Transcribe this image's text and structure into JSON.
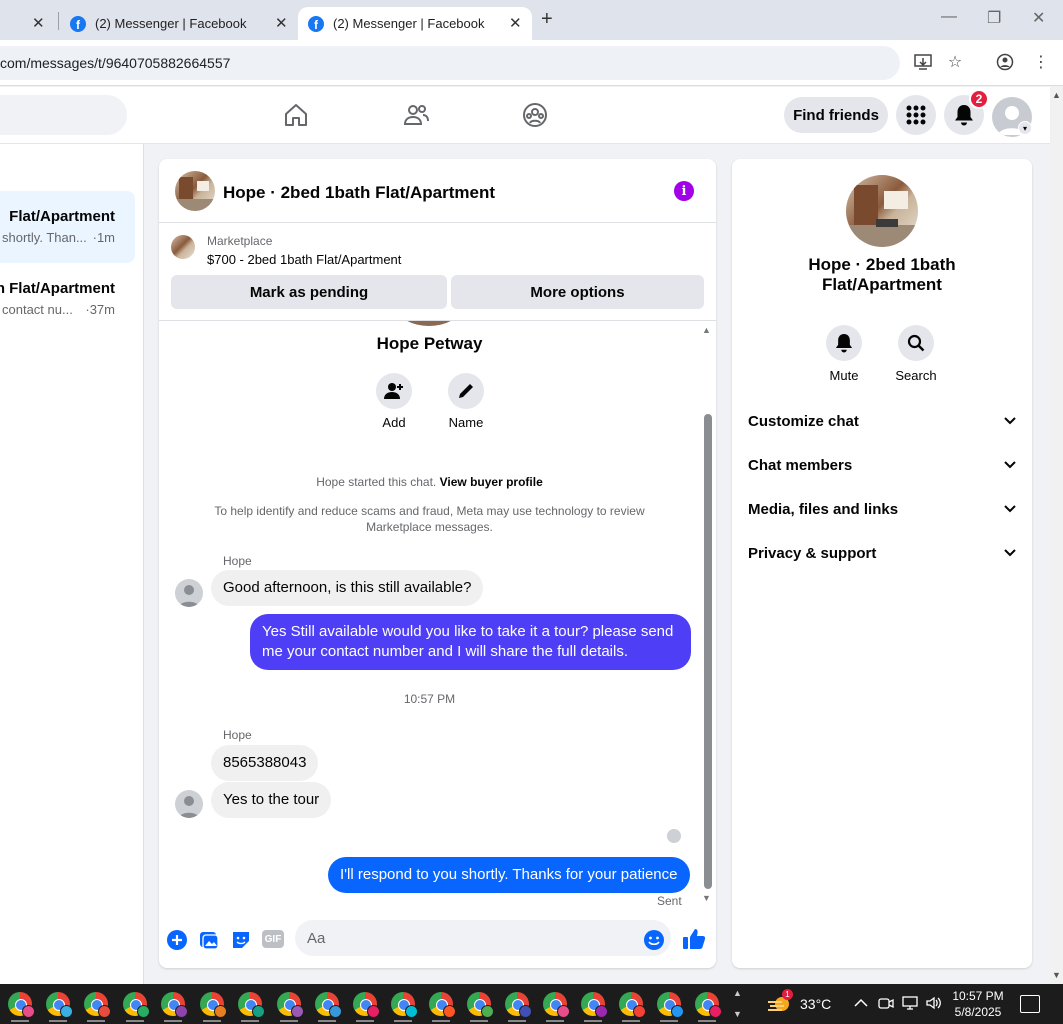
{
  "browser": {
    "tabs": [
      {
        "title": ""
      },
      {
        "title": "(2) Messenger | Facebook"
      },
      {
        "title": "(2) Messenger | Facebook"
      }
    ],
    "url": "com/messages/t/9640705882664557"
  },
  "fb_nav": {
    "find_friends": "Find friends",
    "notification_count": "2"
  },
  "chat_list": [
    {
      "title": "Flat/Apartment",
      "preview": "shortly. Than...",
      "time": "·1m",
      "active": true
    },
    {
      "title": "h Flat/Apartment",
      "preview": "contact nu...",
      "time": "·37m",
      "active": false
    }
  ],
  "chat": {
    "title": "Hope · 2bed 1bath Flat/Apartment",
    "marketplace_label": "Marketplace",
    "listing": "$700 - 2bed 1bath Flat/Apartment",
    "mark_pending": "Mark as pending",
    "more_options": "More options",
    "profile_name": "Hope Petway",
    "profile_actions": [
      {
        "label": "Add",
        "icon": "add-person-icon"
      },
      {
        "label": "Name",
        "icon": "pencil-icon"
      }
    ],
    "started_text": "Hope started this chat.",
    "buyer_profile_link": "View buyer profile",
    "scam_notice_line1": "To help identify and reduce scams and fraud, Meta may use technology to review",
    "scam_notice_line2": "Marketplace messages.",
    "messages": [
      {
        "sender": "Hope",
        "text": "Good afternoon, is this still available?"
      },
      {
        "text_line1": "Yes Still available would you like to take it a tour? please send",
        "text_line2": "me your contact number and I will share the full details."
      },
      {
        "timestamp": "10:57 PM"
      },
      {
        "sender": "Hope",
        "text": "8565388043"
      },
      {
        "text": "Yes to the tour"
      },
      {
        "text": "I'll respond to you shortly. Thanks for your patience",
        "status": "Sent"
      }
    ],
    "composer_placeholder": "Aa",
    "gif_label": "GIF"
  },
  "info_panel": {
    "name_line1": "Hope · 2bed 1bath",
    "name_line2": "Flat/Apartment",
    "actions": [
      {
        "label": "Mute",
        "icon": "bell-icon"
      },
      {
        "label": "Search",
        "icon": "search-icon"
      }
    ],
    "sections": [
      "Customize chat",
      "Chat members",
      "Media, files and links",
      "Privacy & support"
    ]
  },
  "taskbar": {
    "weather_badge": "1",
    "temperature": "33°C",
    "time": "10:57 PM",
    "date": "5/8/2025"
  },
  "colors": {
    "messenger_purple": "#4e3ff6",
    "messenger_blue": "#0866ff",
    "fb_blue": "#1877f2",
    "info_purple": "#a200e8"
  }
}
